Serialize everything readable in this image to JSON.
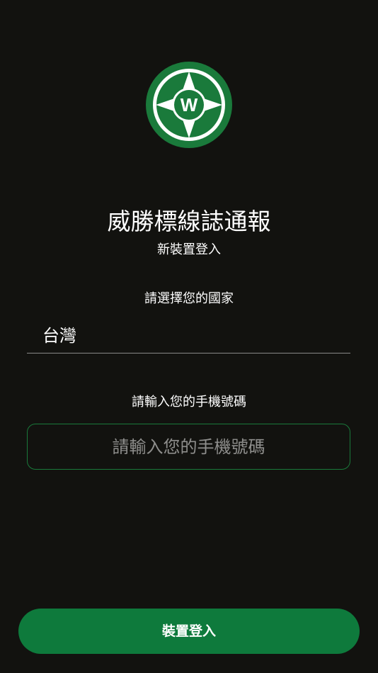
{
  "branding": {
    "logo_icon": "w-compass-logo-icon",
    "logo_letter": "W",
    "title": "威勝標線誌通報",
    "subtitle": "新裝置登入",
    "colors": {
      "brand_green": "#1a7a3b",
      "button_green": "#0e7a3c",
      "background": "#12120f"
    }
  },
  "country": {
    "label": "請選擇您的國家",
    "selected": "台灣"
  },
  "phone": {
    "label": "請輸入您的手機號碼",
    "placeholder": "請輸入您的手機號碼",
    "value": ""
  },
  "actions": {
    "login_label": "裝置登入"
  }
}
